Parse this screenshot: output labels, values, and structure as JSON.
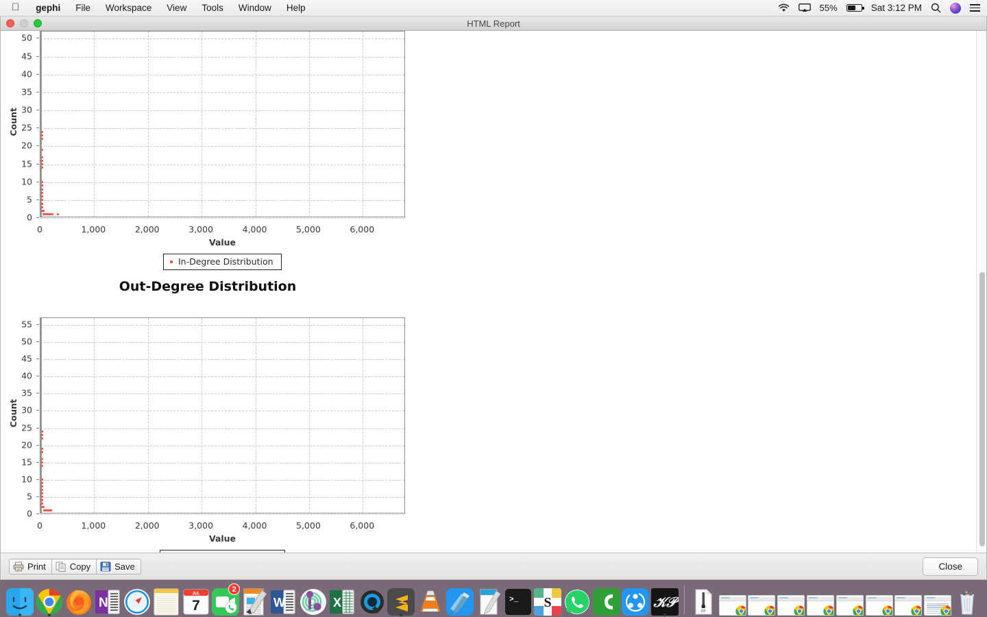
{
  "menubar": {
    "apple_icon": "apple-logo",
    "items": [
      "gephi",
      "File",
      "Workspace",
      "View",
      "Tools",
      "Window",
      "Help"
    ],
    "status": {
      "wifi_icon": "wifi-icon",
      "airplay_icon": "airplay-icon",
      "battery_percent": "55%",
      "battery_icon": "battery-icon",
      "datetime": "Sat 3:12 PM",
      "search_icon": "spotlight-search-icon",
      "siri_icon": "siri-icon",
      "control_center_icon": "notification-center-icon"
    }
  },
  "window": {
    "title": "HTML Report",
    "traffic_lights": [
      "close",
      "minimize",
      "zoom"
    ]
  },
  "toolbar": {
    "print_label": "Print",
    "copy_label": "Copy",
    "save_label": "Save",
    "close_label": "Close"
  },
  "chart_data": [
    {
      "type": "scatter",
      "title": "In-Degree Distribution",
      "xlabel": "Value",
      "ylabel": "Count",
      "xlim": [
        0,
        6800
      ],
      "ylim": [
        0,
        52
      ],
      "xticks": [
        "0",
        "1,000",
        "2,000",
        "3,000",
        "4,000",
        "5,000",
        "6,000"
      ],
      "xtick_values": [
        0,
        1000,
        2000,
        3000,
        4000,
        5000,
        6000
      ],
      "yticks": [
        "0",
        "5",
        "10",
        "15",
        "20",
        "25",
        "30",
        "35",
        "40",
        "45",
        "50"
      ],
      "ytick_values": [
        0,
        5,
        10,
        15,
        20,
        25,
        30,
        35,
        40,
        45,
        50
      ],
      "grid": true,
      "legend": "In-Degree Distribution",
      "legend_position": "bottom-center",
      "color": "#f2554f",
      "points": [
        [
          1,
          24
        ],
        [
          2,
          23
        ],
        [
          2,
          22
        ],
        [
          3,
          19
        ],
        [
          4,
          17
        ],
        [
          4,
          16
        ],
        [
          5,
          15
        ],
        [
          6,
          14
        ],
        [
          7,
          10
        ],
        [
          8,
          9
        ],
        [
          9,
          9
        ],
        [
          10,
          8
        ],
        [
          12,
          7
        ],
        [
          14,
          6
        ],
        [
          16,
          5
        ],
        [
          18,
          4
        ],
        [
          20,
          4
        ],
        [
          24,
          3
        ],
        [
          28,
          3
        ],
        [
          34,
          2
        ],
        [
          40,
          2
        ],
        [
          46,
          2
        ],
        [
          55,
          2
        ],
        [
          62,
          1
        ],
        [
          75,
          1
        ],
        [
          90,
          1
        ],
        [
          110,
          1
        ],
        [
          130,
          1
        ],
        [
          160,
          1
        ],
        [
          190,
          1
        ],
        [
          220,
          1
        ],
        [
          330,
          1
        ]
      ]
    },
    {
      "type": "scatter",
      "title": "Out-Degree Distribution",
      "xlabel": "Value",
      "ylabel": "Count",
      "xlim": [
        0,
        6800
      ],
      "ylim": [
        0,
        57
      ],
      "xticks": [
        "0",
        "1,000",
        "2,000",
        "3,000",
        "4,000",
        "5,000",
        "6,000"
      ],
      "xtick_values": [
        0,
        1000,
        2000,
        3000,
        4000,
        5000,
        6000
      ],
      "yticks": [
        "0",
        "5",
        "10",
        "15",
        "20",
        "25",
        "30",
        "35",
        "40",
        "45",
        "50",
        "55"
      ],
      "ytick_values": [
        0,
        5,
        10,
        15,
        20,
        25,
        30,
        35,
        40,
        45,
        50,
        55
      ],
      "grid": true,
      "legend": "Out-Degree Distribution",
      "legend_position": "bottom-center",
      "color": "#f2554f",
      "points": [
        [
          1,
          24
        ],
        [
          2,
          23
        ],
        [
          2,
          22
        ],
        [
          3,
          19
        ],
        [
          4,
          18
        ],
        [
          5,
          16
        ],
        [
          5,
          15
        ],
        [
          6,
          14
        ],
        [
          7,
          10
        ],
        [
          8,
          9
        ],
        [
          9,
          8
        ],
        [
          10,
          8
        ],
        [
          12,
          7
        ],
        [
          14,
          6
        ],
        [
          16,
          5
        ],
        [
          18,
          4
        ],
        [
          20,
          4
        ],
        [
          22,
          3
        ],
        [
          26,
          3
        ],
        [
          30,
          3
        ],
        [
          36,
          2
        ],
        [
          42,
          2
        ],
        [
          50,
          2
        ],
        [
          58,
          2
        ],
        [
          66,
          1
        ],
        [
          78,
          1
        ],
        [
          92,
          1
        ],
        [
          110,
          1
        ],
        [
          128,
          1
        ],
        [
          150,
          1
        ],
        [
          175,
          1
        ],
        [
          200,
          1
        ]
      ]
    }
  ],
  "dock": {
    "items": [
      {
        "name": "finder",
        "running": true
      },
      {
        "name": "google-chrome",
        "running": true
      },
      {
        "name": "firefox",
        "running": false
      },
      {
        "name": "onenote",
        "running": false
      },
      {
        "name": "safari",
        "running": false
      },
      {
        "name": "notes",
        "running": false
      },
      {
        "name": "calendar",
        "running": false,
        "month": "JUL",
        "day": "7"
      },
      {
        "name": "facetime",
        "running": false,
        "badge": "2"
      },
      {
        "name": "pages",
        "running": false
      },
      {
        "name": "microsoft-word",
        "running": false
      },
      {
        "name": "rstudio",
        "running": false
      },
      {
        "name": "microsoft-excel",
        "running": false
      },
      {
        "name": "quicksilver",
        "running": false
      },
      {
        "name": "sublime-text",
        "running": true
      },
      {
        "name": "vlc",
        "running": false
      },
      {
        "name": "xcode",
        "running": false
      },
      {
        "name": "preview",
        "running": false
      },
      {
        "name": "terminal",
        "running": false
      },
      {
        "name": "slack",
        "running": false
      },
      {
        "name": "whatsapp",
        "running": false
      },
      {
        "name": "camtasia",
        "running": false
      },
      {
        "name": "shareit",
        "running": false
      },
      {
        "name": "gephi",
        "running": true
      }
    ],
    "minimized_label": "ZIP",
    "minimized_windows": 8,
    "trash": "trash-icon"
  }
}
